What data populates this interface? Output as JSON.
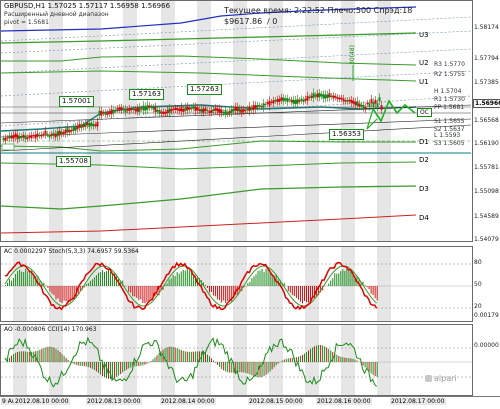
{
  "header": {
    "symbol_line": "GBPUSD,H1  1.57025 1.57117 1.56958 1.56966",
    "indicator_name": "Расширенный дневной диапазон",
    "pivot_text": "pivot = 1.5681",
    "time_line": "Текущее время: 2:22:52 Плечо:500 Спрэд:18",
    "balance": "$9617.86",
    "slash": "/ 0"
  },
  "levels": {
    "U3": "U3",
    "U2": "U2",
    "U1": "U1",
    "D1": "D1",
    "D2": "D2",
    "D3": "D3",
    "D4": "D4",
    "OC": "OC",
    "arrow": "30(48)"
  },
  "price_boxes": [
    "1.57001",
    "1.57163",
    "1.57263",
    "1.56353",
    "1.55708"
  ],
  "pivot_labels": {
    "R3": "R3 1.5770",
    "R2": "R2 1.5755",
    "R1": "R1 1.5730",
    "PP": "PP 1.5681",
    "S1": "S1 1.5655",
    "S2": "S2 1.5637",
    "S3": "S3 1.5605",
    "H": "H 1.5704",
    "L": "L 1.5593"
  },
  "main_axis": [
    "1.58174",
    "1.57794",
    "1.57385",
    "1.56966",
    "1.56568",
    "1.56190",
    "1.55781",
    "1.55098",
    "1.54589",
    "1.54079"
  ],
  "main_axis_current": "1.56966",
  "ac_title": "AC 0.0002297  Stoch(5,3,3) 74.6957 59.5364",
  "ac_axis": [
    "80",
    "50",
    "20",
    "0.00179"
  ],
  "ao_title": "AO -0.000806  CCI(14) 170.963",
  "ao_axis": [
    "0.00000"
  ],
  "watermark": "alpari",
  "time_axis": [
    "9 Aug 2012",
    "2012.08.10 00:00",
    "2012.08.13 00:00",
    "2012.08.14 00:00",
    "2012.08.15 00:00",
    "2012.08.16 00:00",
    "2012.08.17 00:00"
  ],
  "colors": {
    "bull": "#1a8a1a",
    "bear": "#d01010",
    "band_green": "#3a9a2a",
    "band_red": "#d02020",
    "teal": "#008080",
    "blue": "#2030c0",
    "stoch_red": "#e00000"
  }
}
